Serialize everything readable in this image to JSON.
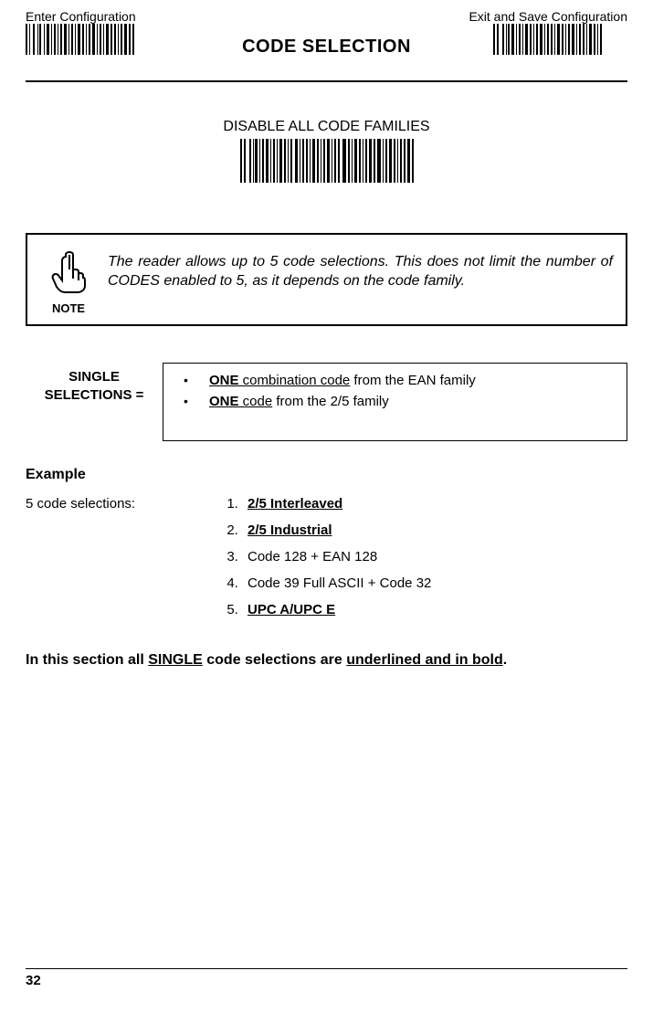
{
  "header": {
    "left": "Enter Configuration",
    "right": "Exit and Save Configuration",
    "title": "CODE SELECTION"
  },
  "disable_block": {
    "label": "DISABLE ALL CODE FAMILIES"
  },
  "note": {
    "label": "NOTE",
    "text": "The reader allows up to 5 code selections. This does not limit the number of CODES enabled to 5, as it depends on the code family."
  },
  "single": {
    "label_line1": "SINGLE",
    "label_line2": "SELECTIONS =",
    "item1_bold": "ONE",
    "item1_under": " combination code",
    "item1_rest": " from the EAN family",
    "item2_bold": "ONE",
    "item2_under": " code",
    "item2_rest": " from the 2/5 family"
  },
  "example": {
    "heading": "Example",
    "left_label": "5 code selections:",
    "items": {
      "i1": "2/5 Interleaved",
      "i2": "2/5 Industrial",
      "i3": "Code 128 + EAN 128",
      "i4": "Code 39 Full ASCII + Code 32",
      "i5": "UPC A/UPC E"
    }
  },
  "rule": {
    "pre": "In this section all ",
    "mid": "SINGLE",
    "between": " code selections are ",
    "end_u": "underlined and in bold",
    "dot": "."
  },
  "footer": {
    "page": "32"
  }
}
